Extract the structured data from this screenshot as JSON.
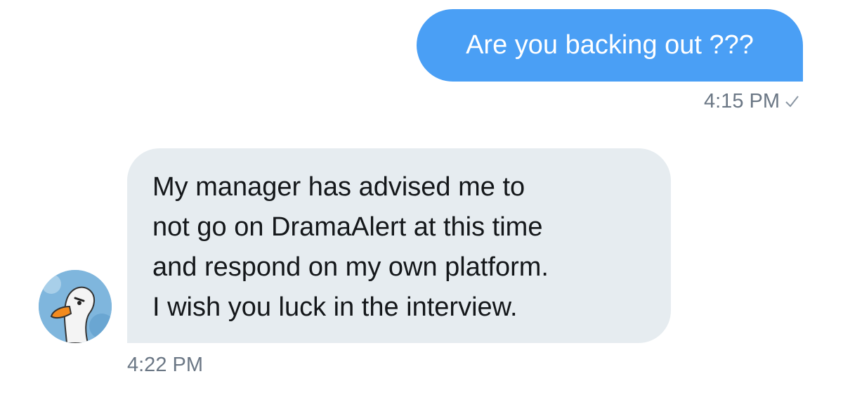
{
  "messages": {
    "sent": {
      "text": "Are you backing out ???",
      "time": "4:15 PM",
      "status_icon": "check-icon"
    },
    "received": {
      "lines": [
        "My manager has advised me to",
        "not go on DramaAlert at this time",
        "and respond on my own platform.",
        "I wish you luck in the interview."
      ],
      "time": "4:22 PM",
      "avatar_icon": "goose-avatar"
    }
  },
  "colors": {
    "sent_bubble": "#4a9ff5",
    "received_bubble": "#e6ecf0",
    "timestamp": "#6b7785",
    "text_dark": "#14171a",
    "text_light": "#ffffff"
  }
}
